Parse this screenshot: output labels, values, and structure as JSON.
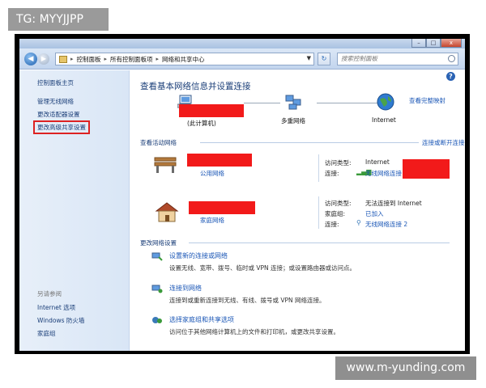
{
  "watermarks": {
    "top_left": "TG: MYYJJPP",
    "bottom_right": "www.m-yunding.com"
  },
  "window": {
    "minimize": "–",
    "maximize": "□",
    "close": "x"
  },
  "address_bar": {
    "breadcrumbs": [
      "控制面板",
      "所有控制面板项",
      "网络和共享中心"
    ],
    "search_placeholder": "搜索控制面板",
    "refresh_glyph": "↻"
  },
  "left_pane": {
    "home": "控制面板主页",
    "links": [
      "管理无线网络",
      "更改适配器设置",
      "更改高级共享设置"
    ],
    "see_also_header": "另请参阅",
    "see_also": [
      "Internet 选项",
      "Windows 防火墙",
      "家庭组"
    ]
  },
  "content": {
    "title": "查看基本网络信息并设置连接",
    "full_map_link": "查看完整映射",
    "map": {
      "this_computer": "(此计算机)",
      "middle": "多重网络",
      "internet": "Internet"
    },
    "active_section": {
      "header": "查看活动网络",
      "connect_link": "连接或断开连接",
      "networks": [
        {
          "type": "公用网络",
          "access_label": "访问类型:",
          "access_value": "Internet",
          "conn_label": "连接:",
          "conn_value": "无线网络连接"
        },
        {
          "type": "家庭网络",
          "access_label": "访问类型:",
          "access_value": "无法连接到 Internet",
          "homegroup_label": "家庭组:",
          "homegroup_value": "已加入",
          "conn_label": "连接:",
          "conn_value": "无线网络连接 2"
        }
      ]
    },
    "change_section": {
      "header": "更改网络设置",
      "tasks": [
        {
          "link": "设置新的连接或网络",
          "desc": "设置无线、宽带、拨号、临时或 VPN 连接；或设置路由器或访问点。"
        },
        {
          "link": "连接到网络",
          "desc": "连接到或重新连接到无线、有线、拨号或 VPN 网络连接。"
        },
        {
          "link": "选择家庭组和共享选项",
          "desc": "访问位于其他网络计算机上的文件和打印机，或更改共享设置。"
        }
      ]
    }
  }
}
